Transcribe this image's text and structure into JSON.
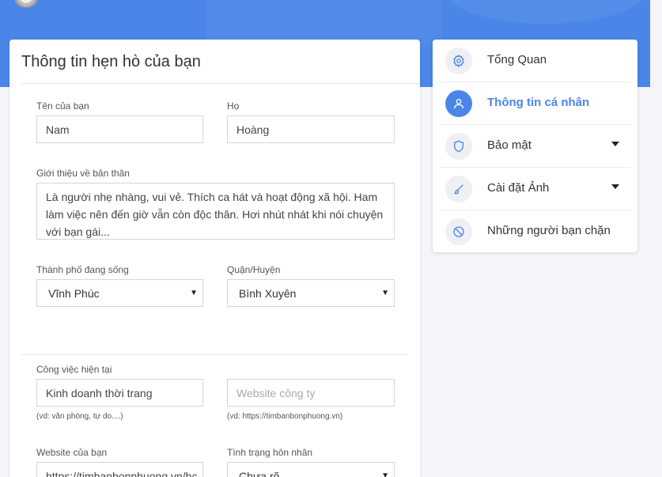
{
  "form": {
    "title": "Thông tin hẹn hò của bạn",
    "first_name": {
      "label": "Tên của bạn",
      "value": "Nam"
    },
    "last_name": {
      "label": "Họ",
      "value": "Hoàng"
    },
    "bio": {
      "label": "Giới thiệu về bản thân",
      "line1": "Là người nhẹ nhàng, vui vẻ. Thích ca hát và hoạt động xã hội. Ham",
      "line2": "làm việc nên đến giờ vẫn còn độc thân. Hơi nhút nhát khi nói chuyện",
      "line3": "với bạn gái..."
    },
    "city": {
      "label": "Thành phố đang sống",
      "value": "Vĩnh Phúc"
    },
    "district": {
      "label": "Quận/Huyện",
      "value": "Bình Xuyên"
    },
    "job": {
      "label": "Công việc hiện tại",
      "value": "Kinh doanh thời trang",
      "hint": "(vd: văn phòng, tự do....)"
    },
    "company_website": {
      "placeholder": "Website công ty",
      "hint": "(vd: https://timbanbonphuong.vn)"
    },
    "personal_website": {
      "label": "Website của bạn",
      "value": "https://timbanbonphuong.vn/bc"
    },
    "marital_status": {
      "label": "Tình trạng hôn nhân",
      "value": "Chưa rõ"
    }
  },
  "menu": {
    "items": [
      {
        "label": "Tổng Quan",
        "icon": "gear-icon"
      },
      {
        "label": "Thông tin cá nhân",
        "icon": "user-icon",
        "active": true
      },
      {
        "label": "Bảo mật",
        "icon": "shield-icon"
      },
      {
        "label": "Cài đặt Ảnh",
        "icon": "brush-icon"
      },
      {
        "label": "Những người bạn chặn",
        "icon": "block-icon"
      }
    ]
  },
  "colors": {
    "accent": "#4a86e8",
    "header": "#4a86e8",
    "background": "#f4f5f8"
  }
}
